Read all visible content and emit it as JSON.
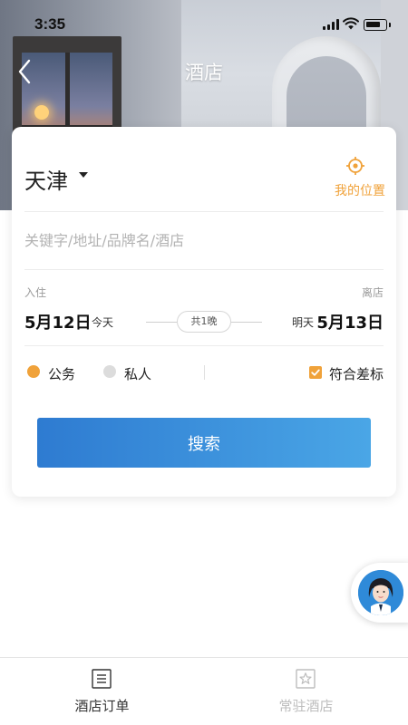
{
  "status_bar": {
    "time": "3:35"
  },
  "nav": {
    "title": "酒店",
    "back_icon": "chevron-left-icon"
  },
  "search_form": {
    "city": "天津",
    "my_location_label": "我的位置",
    "keyword_placeholder": "关键字/地址/品牌名/酒店",
    "check_in": {
      "label": "入住",
      "date": "5月12日",
      "day": "今天"
    },
    "check_out": {
      "label": "离店",
      "date": "5月13日",
      "day": "明天"
    },
    "nights": "共1晚",
    "trip_type": {
      "options": [
        {
          "label": "公务",
          "selected": true
        },
        {
          "label": "私人",
          "selected": false
        }
      ]
    },
    "policy_checkbox": {
      "label": "符合差标",
      "checked": true
    },
    "search_button": "搜索"
  },
  "tabbar": {
    "tabs": [
      {
        "label": "酒店订单",
        "icon": "document-list-icon",
        "active": true
      },
      {
        "label": "常驻酒店",
        "icon": "star-icon",
        "active": false
      }
    ]
  },
  "colors": {
    "accent_orange": "#f0a23a",
    "button_gradient_start": "#2e7bd1",
    "button_gradient_end": "#4aa6e6",
    "radio_unselected": "#dcdcdc",
    "tab_active": "#333333",
    "tab_inactive": "#bdbdbd"
  }
}
